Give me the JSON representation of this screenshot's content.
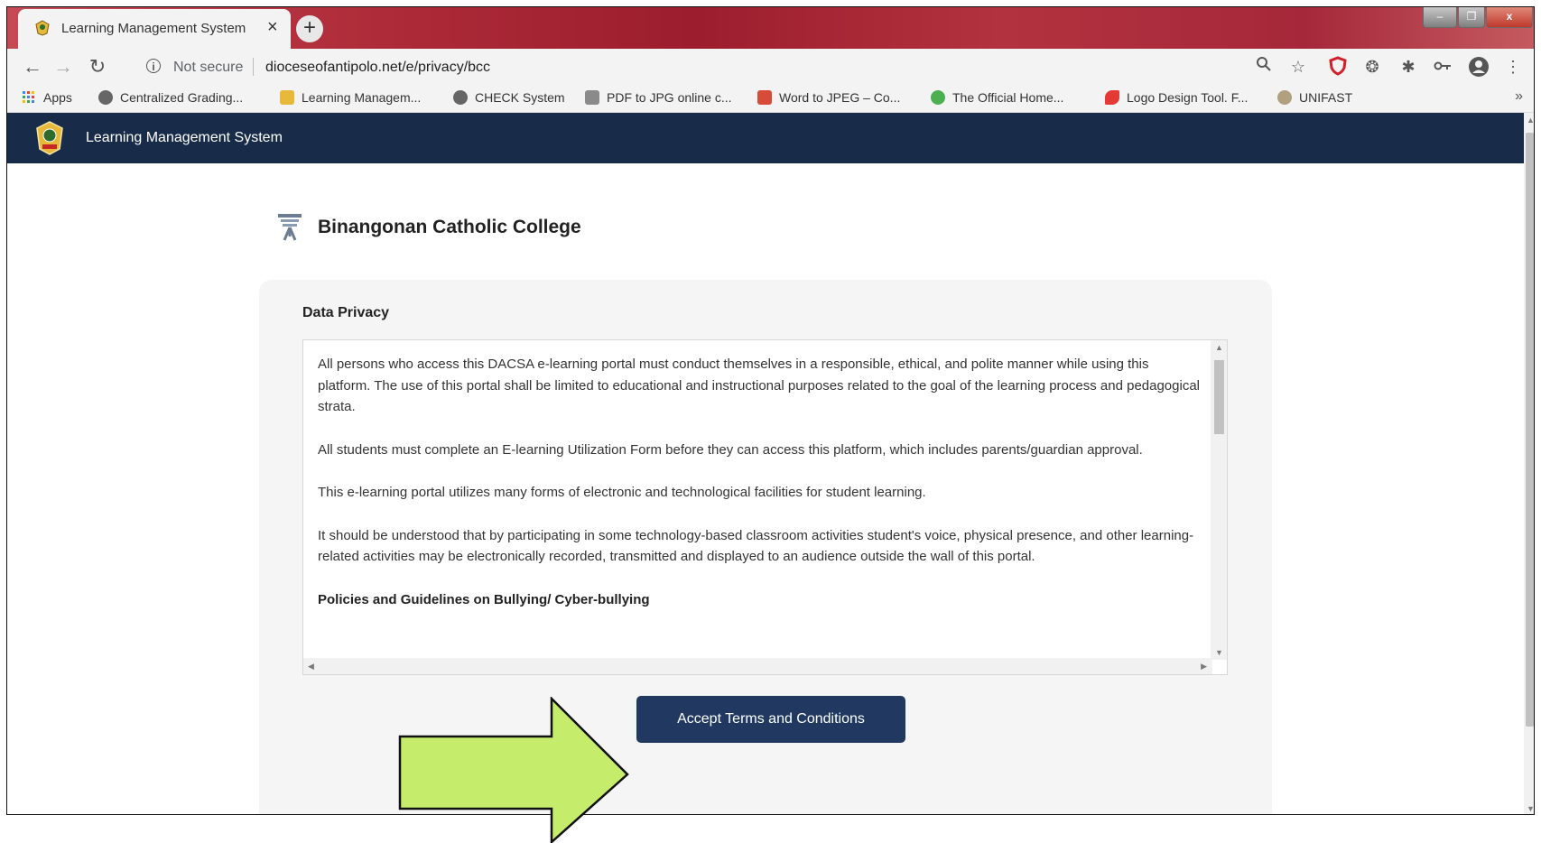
{
  "browser": {
    "tab_title": "Learning Management System",
    "tab_close": "×",
    "new_tab": "+",
    "window_minimize": "‒",
    "window_maximize": "❐",
    "window_close": "x",
    "security_label": "Not secure",
    "url": "dioceseofantipolo.net/e/privacy/bcc",
    "bookmarks": [
      {
        "label": "Apps",
        "icon": "apps-grid-icon"
      },
      {
        "label": "Centralized Grading...",
        "icon": "globe-icon"
      },
      {
        "label": "Learning Managem...",
        "icon": "school-crest-icon"
      },
      {
        "label": "CHECK System",
        "icon": "globe-icon"
      },
      {
        "label": "PDF to JPG online c...",
        "icon": "pdf-jpg-icon"
      },
      {
        "label": "Word to JPEG – Co...",
        "icon": "doc-jpg-icon"
      },
      {
        "label": "The Official Home...",
        "icon": "official-home-icon"
      },
      {
        "label": "Logo Design Tool. F...",
        "icon": "logo-design-icon"
      },
      {
        "label": "UNIFAST",
        "icon": "unifast-icon"
      }
    ],
    "bookmarks_more": "»"
  },
  "header": {
    "title": "Learning Management System"
  },
  "school": {
    "name": "Binangonan Catholic College"
  },
  "privacy": {
    "section_title": "Data Privacy",
    "paragraphs": [
      "All persons who access this DACSA e-learning portal must conduct themselves in a responsible, ethical, and polite manner while using this platform. The use of this portal shall be limited to educational and instructional purposes related to the goal of the learning process and pedagogical strata.",
      "All students must complete an E-learning Utilization Form before they can access this platform, which includes parents/guardian approval.",
      "This e-learning portal utilizes many forms of electronic and technological facilities for student learning.",
      "It should be understood that by participating in some technology-based classroom activities student's voice, physical presence, and other learning-related activities may be electronically recorded, transmitted and displayed to an audience outside the wall of this portal."
    ],
    "policy_heading": "Policies and Guidelines on Bullying/ Cyber-bullying"
  },
  "actions": {
    "accept_label": "Accept Terms and Conditions"
  },
  "colors": {
    "header_bg": "#182b48",
    "button_bg": "#213960",
    "arrow_fill": "#c5ec6a"
  }
}
